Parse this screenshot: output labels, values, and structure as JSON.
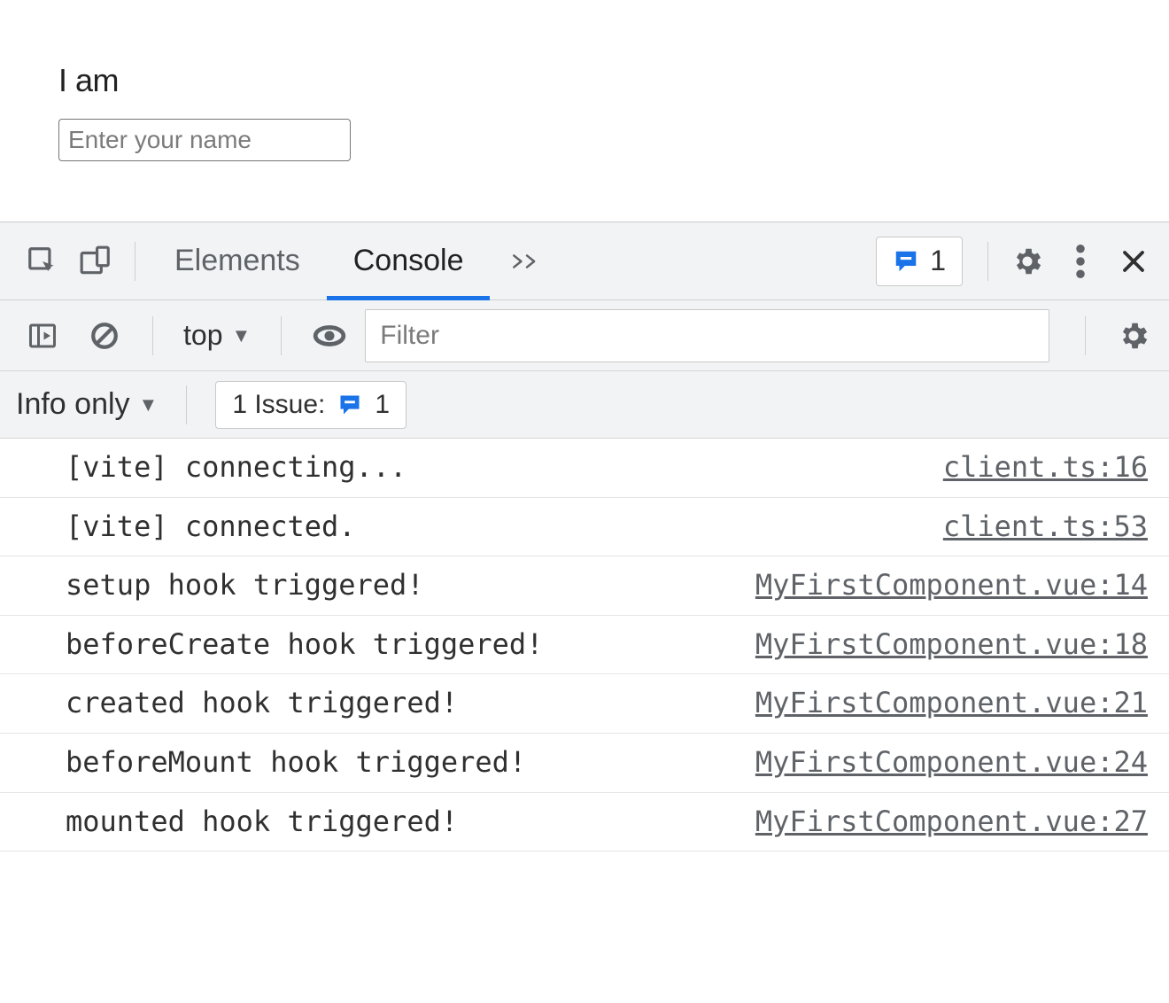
{
  "page": {
    "heading": "I am",
    "name_placeholder": "Enter your name"
  },
  "devtools": {
    "tabs": {
      "elements": "Elements",
      "console": "Console"
    },
    "issues_badge": "1",
    "toolbar": {
      "context_label": "top",
      "filter_placeholder": "Filter"
    },
    "level_row": {
      "level_label": "Info only",
      "issue_chip_label": "1 Issue:",
      "issue_chip_count": "1"
    },
    "logs": [
      {
        "msg": "[vite] connecting...",
        "src": "client.ts:16"
      },
      {
        "msg": "[vite] connected.",
        "src": "client.ts:53"
      },
      {
        "msg": "setup hook triggered!",
        "src": "MyFirstComponent.vue:14"
      },
      {
        "msg": "beforeCreate hook triggered!",
        "src": "MyFirstComponent.vue:18"
      },
      {
        "msg": "created hook triggered!",
        "src": "MyFirstComponent.vue:21"
      },
      {
        "msg": "beforeMount hook triggered!",
        "src": "MyFirstComponent.vue:24"
      },
      {
        "msg": "mounted hook triggered!",
        "src": "MyFirstComponent.vue:27"
      }
    ]
  }
}
